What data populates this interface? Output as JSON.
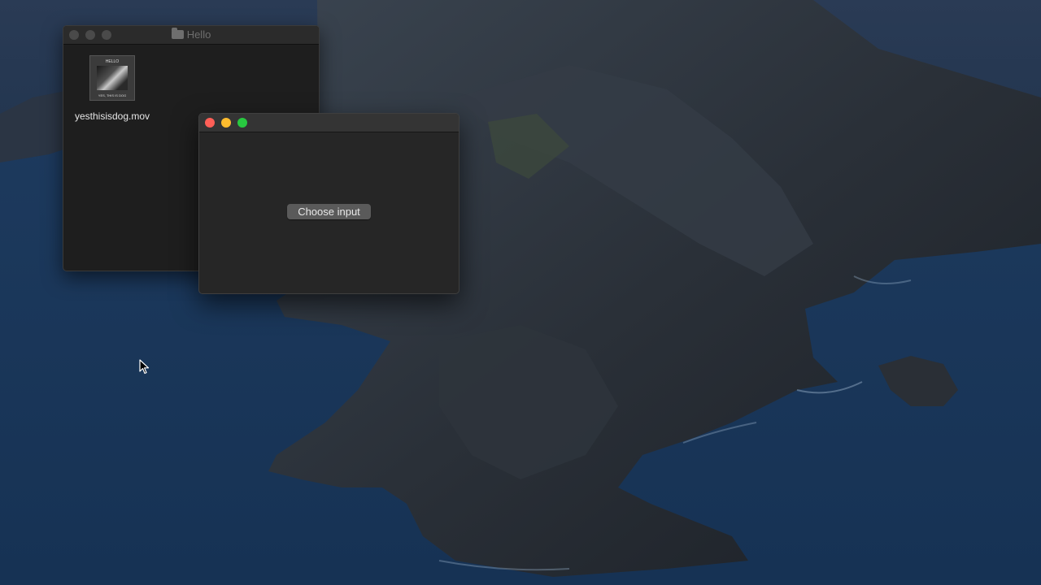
{
  "desktop": {
    "wallpaper": "coastal-cliffs-night"
  },
  "finder_window": {
    "title": "Hello",
    "title_icon": "folder-icon",
    "items": [
      {
        "name": "yesthisisdog.mov",
        "icon": "video-thumbnail",
        "thumbnail_text_top": "HELLO",
        "thumbnail_text_bottom": "YES, THIS IS DOG"
      }
    ]
  },
  "app_window": {
    "title": "",
    "button_label": "Choose input"
  },
  "colors": {
    "close": "#ff5f57",
    "minimize": "#febc2e",
    "maximize": "#28c840",
    "window_bg": "#262626",
    "button_bg": "#5a5a5a"
  }
}
